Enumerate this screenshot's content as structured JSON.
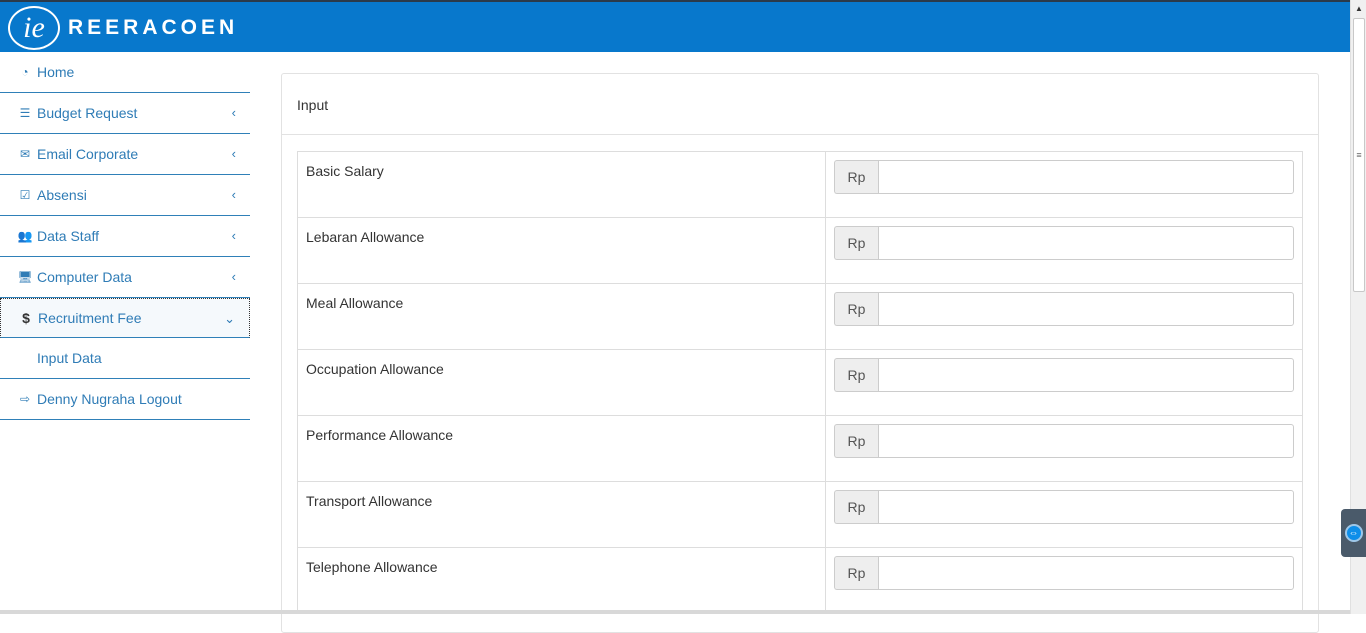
{
  "brand": {
    "name": "REERACOEN",
    "monogram": "ie"
  },
  "sidebar": {
    "items": [
      {
        "label": "Home",
        "icon": "dashboard-icon",
        "glyph": "◔",
        "has_chevron": false
      },
      {
        "label": "Budget Request",
        "icon": "list-icon",
        "glyph": "☰",
        "has_chevron": true
      },
      {
        "label": "Email Corporate",
        "icon": "envelope-icon",
        "glyph": "✉",
        "has_chevron": true
      },
      {
        "label": "Absensi",
        "icon": "checkbox-icon",
        "glyph": "☑",
        "has_chevron": true
      },
      {
        "label": "Data Staff",
        "icon": "users-icon",
        "glyph": "👥",
        "has_chevron": true
      },
      {
        "label": "Computer Data",
        "icon": "desktop-icon",
        "glyph": "🖥",
        "has_chevron": true
      },
      {
        "label": "Recruitment Fee",
        "icon": "dollar-icon",
        "glyph": "$",
        "has_chevron": true,
        "expanded": true
      }
    ],
    "sub_items": [
      {
        "label": "Input Data"
      }
    ],
    "logout": {
      "label": "Denny Nugraha Logout",
      "icon": "sign-out-icon",
      "glyph": "⇨"
    }
  },
  "panel": {
    "heading": "Input",
    "currency_prefix": "Rp",
    "fields": [
      {
        "label": "Basic Salary",
        "value": ""
      },
      {
        "label": "Lebaran Allowance",
        "value": ""
      },
      {
        "label": "Meal Allowance",
        "value": ""
      },
      {
        "label": "Occupation Allowance",
        "value": ""
      },
      {
        "label": "Performance Allowance",
        "value": ""
      },
      {
        "label": "Transport Allowance",
        "value": ""
      },
      {
        "label": "Telephone Allowance",
        "value": ""
      }
    ]
  },
  "colors": {
    "header": "#0878cc",
    "link": "#2f7cb6",
    "border": "#2f80b8"
  }
}
